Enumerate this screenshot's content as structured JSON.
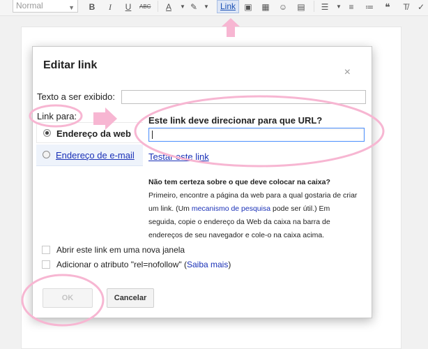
{
  "toolbar": {
    "font_select": "Normal",
    "bold": "B",
    "italic": "I",
    "underline": "U",
    "strikethrough": "ABC",
    "text_color": "A",
    "link": "Link"
  },
  "dialog": {
    "title": "Editar link",
    "close": "×",
    "display_text_label": "Texto a ser exibido:",
    "display_text_value": "",
    "link_to_label": "Link para:",
    "tabs": [
      {
        "label": "Endereço da web",
        "selected": true
      },
      {
        "label": "Endereço de e-mail",
        "selected": false
      }
    ],
    "url_heading": "Este link deve direcionar para que URL?",
    "url_value": "",
    "test_link": "Testar este link",
    "help": {
      "question": "Não tem certeza sobre o que deve colocar na caixa?",
      "text1": "Primeiro, encontre a página da web para a qual gostaria de criar um link. (Um ",
      "search_link": "mecanismo de pesquisa",
      "text2": " pode ser útil.) Em seguida, copie o endereço da Web da caixa na barra de endereços de seu navegador e cole-o na caixa acima."
    },
    "checkbox_new_window": "Abrir este link em uma nova janela",
    "checkbox_nofollow": "Adicionar o atributo \"rel=nofollow\"",
    "learn_more_open": " (",
    "learn_more": "Saiba mais",
    "learn_more_close": ")",
    "ok": "OK",
    "cancel": "Cancelar"
  },
  "colors": {
    "annotation_pink": "#f7b6d2",
    "link_blue": "#1a31b7",
    "focus_blue": "#4d90fe"
  }
}
